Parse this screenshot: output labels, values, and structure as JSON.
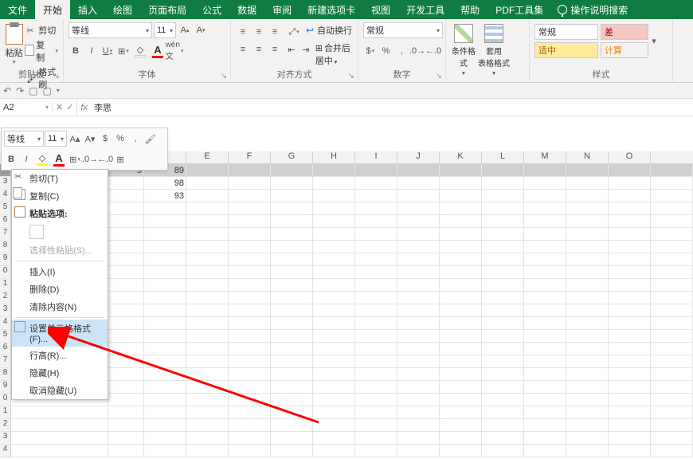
{
  "tabs": [
    "文件",
    "开始",
    "插入",
    "绘图",
    "页面布局",
    "公式",
    "数据",
    "审阅",
    "新建选项卡",
    "视图",
    "开发工具",
    "帮助",
    "PDF工具集"
  ],
  "tabs_hint": "操作说明搜索",
  "clipboard": {
    "paste": "粘贴",
    "cut": "剪切",
    "copy": "复制",
    "brush": "格式刷",
    "label": "剪贴板"
  },
  "font": {
    "name": "等线",
    "size": "11",
    "label": "字体"
  },
  "align": {
    "wrap": "自动换行",
    "merge": "合并后居中",
    "label": "对齐方式"
  },
  "number": {
    "format": "常规",
    "label": "数字"
  },
  "styles": {
    "cond": "条件格式",
    "table": "套用\n表格格式",
    "label": "样式"
  },
  "presets": {
    "normal": "常规",
    "bad": "差",
    "mid": "适中",
    "calc": "计算"
  },
  "namebox": "A2",
  "formula": "李思",
  "columns": [
    "E",
    "F",
    "G",
    "H",
    "I",
    "J",
    "K",
    "L",
    "M",
    "N",
    "O"
  ],
  "row_numbers": [
    "2",
    "3",
    "4",
    "5",
    "6",
    "7",
    "8",
    "9",
    "0",
    "1",
    "2",
    "3",
    "4",
    "5",
    "6",
    "7",
    "8",
    "9",
    "0",
    "1",
    "2",
    "3",
    "4"
  ],
  "visible_data": {
    "row2": {
      "a": "李思",
      "b": "5",
      "d": "89"
    },
    "row3": {
      "d": "98"
    },
    "row4": {
      "d": "93"
    }
  },
  "mini": {
    "font": "等线",
    "size": "11"
  },
  "context_menu": {
    "cut": "剪切(T)",
    "copy": "复制(C)",
    "paste_opts": "粘贴选项:",
    "paste_special": "选择性粘贴(S)...",
    "insert": "插入(I)",
    "delete": "删除(D)",
    "clear": "清除内容(N)",
    "format": "设置单元格格式(F)...",
    "row_height": "行高(R)...",
    "hide": "隐藏(H)",
    "unhide": "取消隐藏(U)"
  }
}
